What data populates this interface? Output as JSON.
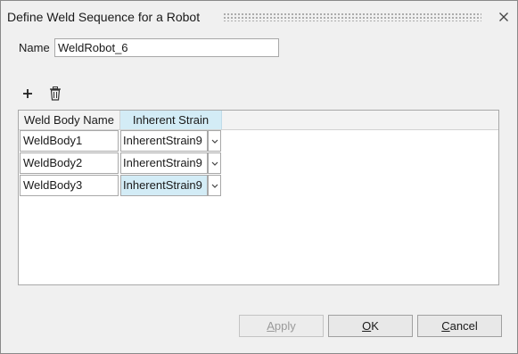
{
  "dialog": {
    "title": "Define Weld Sequence for a Robot"
  },
  "name_field": {
    "label": "Name",
    "value": "WeldRobot_6"
  },
  "toolbar": {
    "add_icon": "plus-icon",
    "delete_icon": "trash-icon"
  },
  "table": {
    "columns": [
      "Weld Body Name",
      "Inherent Strain"
    ],
    "rows": [
      {
        "weld_body": "WeldBody1",
        "inherent_strain": "InherentStrain9",
        "selected": false
      },
      {
        "weld_body": "WeldBody2",
        "inherent_strain": "InherentStrain9",
        "selected": false
      },
      {
        "weld_body": "WeldBody3",
        "inherent_strain": "InherentStrain9",
        "selected": true
      }
    ]
  },
  "buttons": {
    "apply": {
      "mnemonic": "A",
      "rest": "pply",
      "enabled": false
    },
    "ok": {
      "mnemonic": "O",
      "rest": "K",
      "enabled": true
    },
    "cancel": {
      "mnemonic": "C",
      "rest": "ancel",
      "enabled": true
    }
  },
  "colors": {
    "selected_cell": "#d3ecf6",
    "dialog_bg": "#f0f0f0"
  }
}
